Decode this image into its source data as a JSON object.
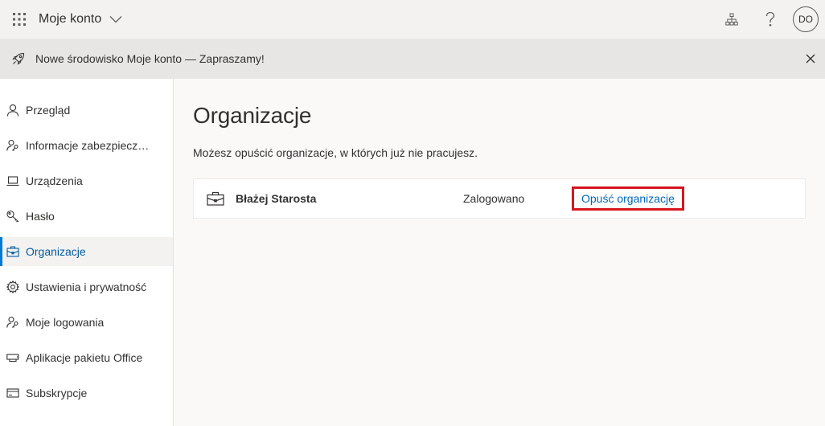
{
  "header": {
    "app_title": "Moje konto",
    "avatar_initials": "DO"
  },
  "banner": {
    "message": "Nowe środowisko Moje konto — Zapraszamy!"
  },
  "sidebar": {
    "items": [
      {
        "label": "Przegląd",
        "icon": "person-icon"
      },
      {
        "label": "Informacje zabezpieczających",
        "icon": "person-key-icon"
      },
      {
        "label": "Urządzenia",
        "icon": "laptop-icon"
      },
      {
        "label": "Hasło",
        "icon": "key-icon"
      },
      {
        "label": "Organizacje",
        "icon": "briefcase-icon",
        "selected": true
      },
      {
        "label": "Ustawienia i prywatność",
        "icon": "gear-icon"
      },
      {
        "label": "Moje logowania",
        "icon": "person-key-icon"
      },
      {
        "label": "Aplikacje pakietu Office",
        "icon": "apps-icon"
      },
      {
        "label": "Subskrypcje",
        "icon": "card-icon"
      }
    ]
  },
  "main": {
    "title": "Organizacje",
    "description": "Możesz opuścić organizacje, w których już nie pracujesz.",
    "organizations": [
      {
        "name": "Błażej Starosta",
        "status": "Zalogowano",
        "action_label": "Opuść organizację"
      }
    ]
  },
  "colors": {
    "accent": "#0078d4",
    "link": "#0067b8",
    "highlight_border": "#d7151f"
  }
}
